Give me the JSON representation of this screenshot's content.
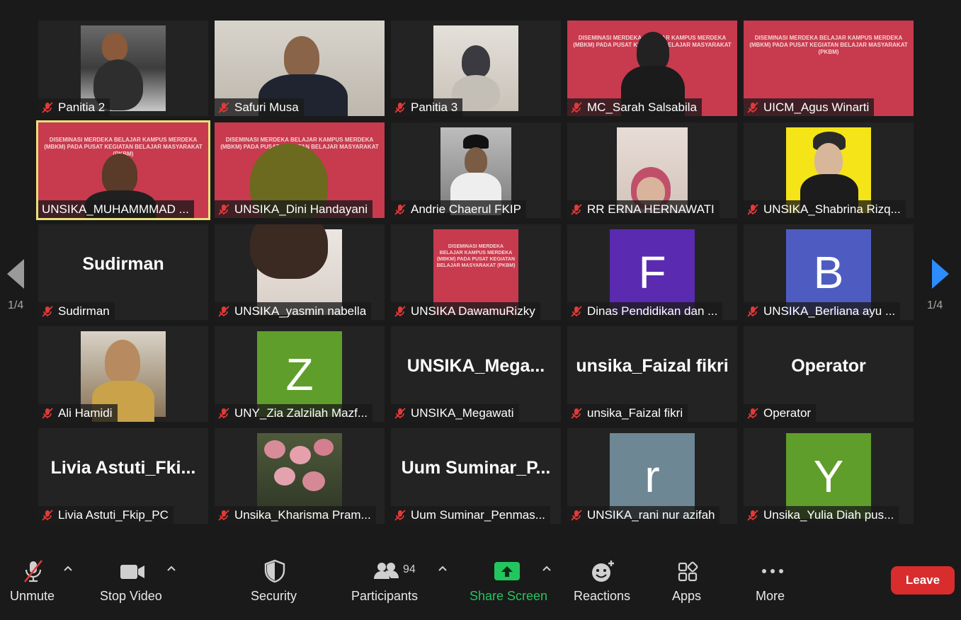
{
  "participants": [
    {
      "name": "Panitia 2"
    },
    {
      "name": "Safuri Musa"
    },
    {
      "name": "Panitia 3"
    },
    {
      "name": "MC_Sarah Salsabila"
    },
    {
      "name": "UICM_Agus Winarti"
    },
    {
      "name": "UNSIKA_MUHAMMMAD ..."
    },
    {
      "name": "UNSIKA_Dini Handayani"
    },
    {
      "name": "Andrie Chaerul FKIP"
    },
    {
      "name": "RR ERNA HERNAWATI"
    },
    {
      "name": "UNSIKA_Shabrina Rizq..."
    },
    {
      "name": "Sudirman",
      "big": "Sudirman"
    },
    {
      "name": "UNSIKA_yasmin nabella"
    },
    {
      "name": "UNSIKA DawamuRizky"
    },
    {
      "name": "Dinas Pendidikan dan ...",
      "letter": "F"
    },
    {
      "name": "UNSIKA_Berliana ayu ...",
      "letter": "B"
    },
    {
      "name": "Ali Hamidi"
    },
    {
      "name": "UNY_Zia Zalzilah Mazf...",
      "letter": "Z"
    },
    {
      "name": "UNSIKA_Megawati",
      "big": "UNSIKA_Mega..."
    },
    {
      "name": "unsika_Faizal fikri",
      "big": "unsika_Faizal fikri"
    },
    {
      "name": "Operator",
      "big": "Operator"
    },
    {
      "name": "Livia Astuti_Fkip_PC",
      "big": "Livia  Astuti_Fki..."
    },
    {
      "name": "Unsika_Kharisma Pram..."
    },
    {
      "name": "Uum Suminar_Penmas...",
      "big": "Uum  Suminar_P..."
    },
    {
      "name": "UNSIKA_rani nur azifah",
      "letter": "r"
    },
    {
      "name": "Unsika_Yulia Diah pus...",
      "letter": "Y"
    }
  ],
  "banner_text": "DISEMINASI MERDEKA BELAJAR KAMPUS MERDEKA (MBKM) PADA PUSAT KEGIATAN BELAJAR MASYARAKAT (PKBM)",
  "pagination": {
    "left": "1/4",
    "right": "1/4"
  },
  "toolbar": {
    "unmute": "Unmute",
    "stop_video": "Stop Video",
    "security": "Security",
    "participants": "Participants",
    "participants_count": "94",
    "share_screen": "Share Screen",
    "reactions": "Reactions",
    "apps": "Apps",
    "more": "More",
    "leave": "Leave"
  },
  "colors": {
    "active_speaker": "#e8e07a",
    "share": "#22c55e",
    "leave": "#d92d2d",
    "mic_off": "#e03a3a",
    "nav_arrow": "#2d8cff"
  }
}
